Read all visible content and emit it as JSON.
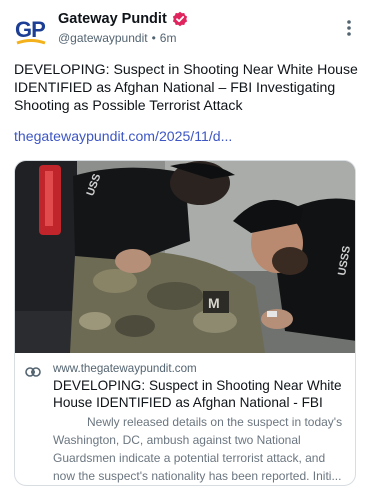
{
  "author": {
    "name": "Gateway Pundit",
    "handle": "@gatewaypundit",
    "separator": "•",
    "time": "6m",
    "avatar_text": "GP"
  },
  "post": {
    "text": "DEVELOPING: Suspect in Shooting Near White House IDENTIFIED as Afghan National – FBI Investigating Shooting as Possible Terrorist Attack",
    "link": "thegatewaypundit.com/2025/11/d..."
  },
  "card": {
    "domain": "www.thegatewaypundit.com",
    "title": "DEVELOPING: Suspect in Shooting Near White House IDENTIFIED as Afghan National - FBI Inv...",
    "description": "Newly released details on the suspect in today's Washington, DC, ambush against two National Guardsmen indicate a potential terrorist attack, and now the suspect's nationality has been reported.  Initi...",
    "image_text": {
      "vest_left": "USS",
      "vest_right": "USSS",
      "patch": "M"
    }
  },
  "icons": {
    "avatar": "gateway-pundit-logo",
    "verified": "verified-badge-icon",
    "more": "more-options-icon",
    "link": "link-icon"
  },
  "colors": {
    "link": "#3d56c4",
    "verified": "#e0245e",
    "secondary_text": "#536471",
    "logo_blue": "#1c3e94",
    "logo_gold": "#f3b21b"
  }
}
